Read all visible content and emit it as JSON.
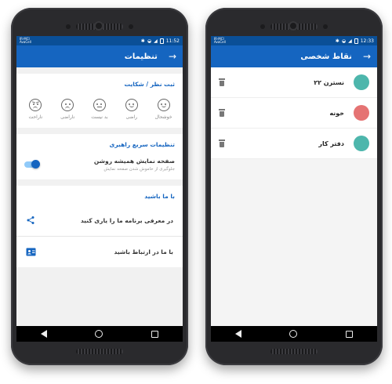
{
  "left": {
    "status": {
      "carrier": "IR-MCI\nAvaCell",
      "time": "11:52"
    },
    "appbar": {
      "title": "تنظیمات",
      "back_icon": "arrow-right-icon"
    },
    "feedback": {
      "title": "ثبت نظر / شکایت",
      "emojis": [
        {
          "label": "خوشحال",
          "icon": "very-happy-face-icon"
        },
        {
          "label": "راضی",
          "icon": "happy-face-icon"
        },
        {
          "label": "بد نیست",
          "icon": "neutral-face-icon"
        },
        {
          "label": "ناراضی",
          "icon": "sad-face-icon"
        },
        {
          "label": "ناراحت",
          "icon": "angry-face-icon"
        }
      ]
    },
    "quick_settings": {
      "title": "تنظیمات سریع راهبری",
      "screen_on": {
        "title": "صفحه نمایش همیشه روشن",
        "subtitle": "جلوگیری از خاموش شدن صفحه نمایش",
        "enabled": true
      }
    },
    "contact": {
      "title": "با ما باشید",
      "items": [
        {
          "label": "در معرفی برنامه ما را یاری کنید",
          "icon": "share-icon"
        },
        {
          "label": "با ما در ارتباط باشید",
          "icon": "contact-card-icon"
        }
      ]
    }
  },
  "right": {
    "status": {
      "carrier": "IR-MCI\nAvaCell",
      "time": "12:33"
    },
    "appbar": {
      "title": "نقاط شخصی",
      "back_icon": "arrow-right-icon"
    },
    "points": [
      {
        "label": "نسترن ۲۲",
        "color": "#4db6ac"
      },
      {
        "label": "خونه",
        "color": "#e57373"
      },
      {
        "label": "دفتر کار",
        "color": "#4db6ac"
      }
    ]
  },
  "colors": {
    "primary": "#1565c0",
    "statusbar": "#0a4f97",
    "toggle_track": "#90caf9"
  }
}
